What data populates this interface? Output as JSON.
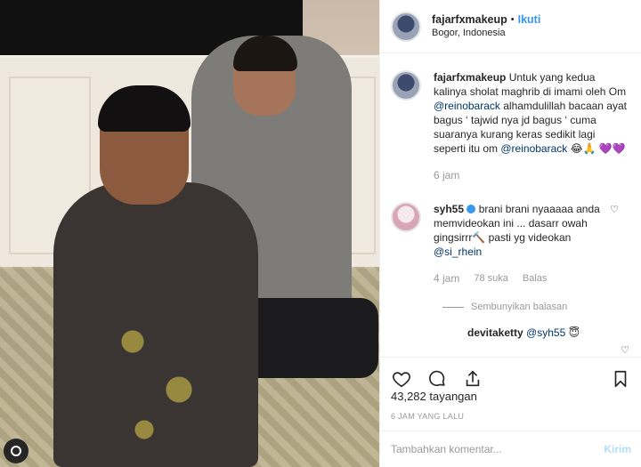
{
  "post": {
    "username": "fajarfxmakeup",
    "separator": "•",
    "follow_label": "Ikuti",
    "location": "Bogor, Indonesia"
  },
  "caption": {
    "username": "fajarfxmakeup",
    "text_1": "Untuk yang kedua kalinya sholat maghrib di imami oleh Om ",
    "mention_1": "@reinobarack",
    "text_2": " alhamdulillah bacaan ayat bagus ‘ tajwid nya jd bagus ‘ cuma suaranya kurang keras sedikit lagi seperti itu om ",
    "mention_2": "@reinobarack",
    "emoji": " 😂🙏 💜💜",
    "time": "6 jam"
  },
  "comments": [
    {
      "username": "syh55",
      "verified": true,
      "text_1": " brani brani nyaaaaa anda memvideokan ini ... dasarr owah gingsirrr🔨 pasti yg videokan ",
      "mention": "@si_rhein",
      "time": "4 jam",
      "likes": "78 suka",
      "reply_label": "Balas",
      "hide_replies_label": "Sembunyikan balasan",
      "reply": {
        "username": "devitaketty",
        "mention": "@syh55",
        "emoji": " 😇"
      }
    }
  ],
  "stats": {
    "views": "43,282 tayangan",
    "time_ago": "6 JAM YANG LALU"
  },
  "comment_box": {
    "placeholder": "Tambahkan komentar...",
    "send_label": "Kirim"
  },
  "icons": {
    "like": "heart-icon",
    "comment": "comment-icon",
    "share": "share-icon",
    "save": "bookmark-icon",
    "media_badge": "instagram-icon"
  },
  "colors": {
    "accent": "#3897f0",
    "mention": "#003569",
    "muted": "#999999",
    "send_disabled": "#b2dffc"
  }
}
